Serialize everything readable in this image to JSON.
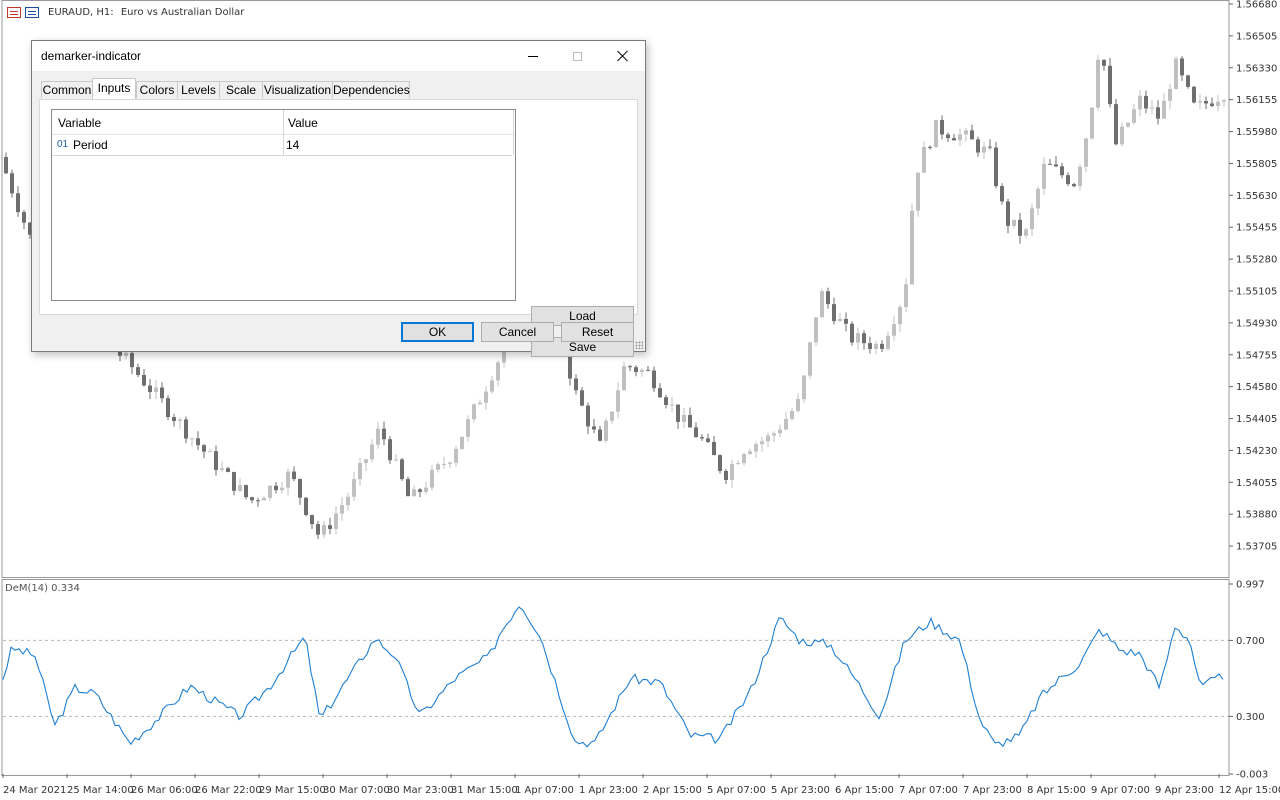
{
  "chart": {
    "symbol": "EURAUD, H1:",
    "description": "Euro vs Australian Dollar",
    "price_axis_labels": [
      "1.56680",
      "1.56505",
      "1.56330",
      "1.56155",
      "1.55980",
      "1.55805",
      "1.55630",
      "1.55455",
      "1.55280",
      "1.55105",
      "1.54930",
      "1.54755",
      "1.54580",
      "1.54405",
      "1.54230",
      "1.54055",
      "1.53880",
      "1.53705"
    ],
    "price_range": [
      1.537,
      1.5668
    ],
    "indicator_label": "DeM(14) 0.334",
    "indicator_axis_labels": [
      "0.997",
      "0.700",
      "0.300",
      "-0.003"
    ],
    "indicator_levels": [
      0.7,
      0.3
    ],
    "indicator_range": [
      -0.003,
      0.997
    ],
    "time_labels": [
      "24 Mar 2021",
      "25 Mar 14:00",
      "26 Mar 06:00",
      "26 Mar 22:00",
      "29 Mar 15:00",
      "30 Mar 07:00",
      "30 Mar 23:00",
      "31 Mar 15:00",
      "1 Apr 07:00",
      "1 Apr 23:00",
      "2 Apr 15:00",
      "5 Apr 07:00",
      "5 Apr 23:00",
      "6 Apr 15:00",
      "7 Apr 07:00",
      "7 Apr 23:00",
      "8 Apr 15:00",
      "9 Apr 07:00",
      "9 Apr 23:00",
      "12 Apr 15:00"
    ],
    "colors": {
      "bull_candle": "#c0c0c0",
      "bear_candle": "#6e6e6e",
      "dem_line": "#1e7fd4",
      "level_line": "#b5b5b5"
    }
  },
  "dialog": {
    "title": "demarker-indicator",
    "tabs": [
      "Common",
      "Inputs",
      "Colors",
      "Levels",
      "Scale",
      "Visualization",
      "Dependencies"
    ],
    "active_tab": "Inputs",
    "grid": {
      "headers": {
        "variable": "Variable",
        "value": "Value"
      },
      "rows": [
        {
          "index": "01",
          "name": "Period",
          "value": "14"
        }
      ]
    },
    "buttons": {
      "load": "Load",
      "save": "Save",
      "ok": "OK",
      "cancel": "Cancel",
      "reset": "Reset"
    }
  }
}
